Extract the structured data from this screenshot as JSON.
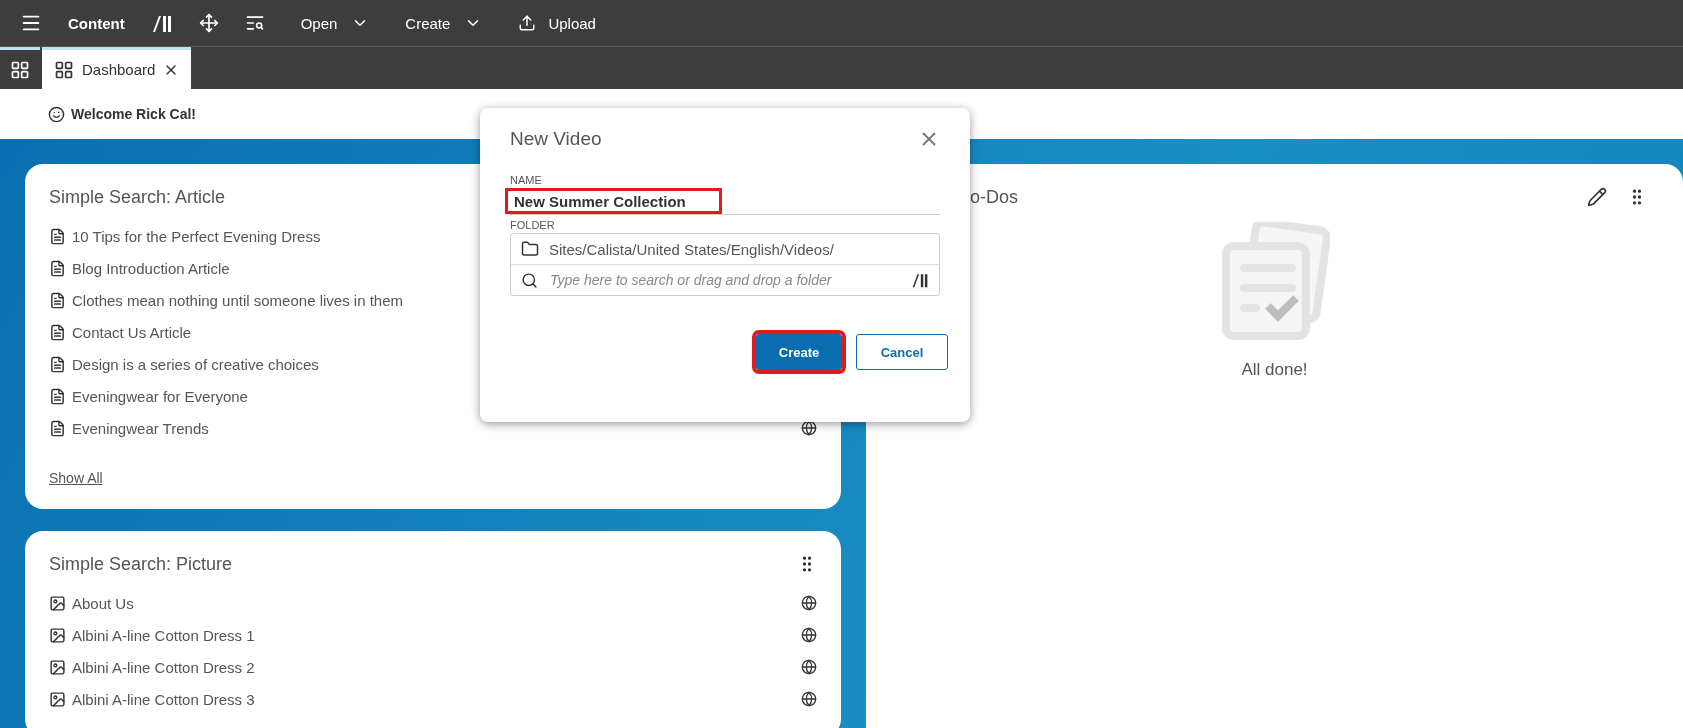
{
  "toolbar": {
    "title": "Content",
    "menus": [
      {
        "label": "Open",
        "kind": "dropdown"
      },
      {
        "label": "Create",
        "kind": "dropdown"
      },
      {
        "label": "Upload",
        "kind": "upload"
      }
    ]
  },
  "tabs": [
    {
      "kind": "home",
      "selected": false
    },
    {
      "kind": "page",
      "label": "Dashboard",
      "selected": true
    }
  ],
  "welcome": "Welcome Rick Cal!",
  "widgets": [
    {
      "title": "Simple Search: Article",
      "kind": "article",
      "items": [
        "10 Tips for the Perfect Evening Dress",
        "Blog Introduction Article",
        "Clothes mean nothing until someone lives in them",
        "Contact Us Article",
        "Design is a series of creative choices",
        "Eveningwear for Everyone",
        "Eveningwear Trends"
      ],
      "link": "Show All"
    },
    {
      "title": "Simple Search: Picture",
      "kind": "picture",
      "items": [
        "About Us",
        "Albini A-line Cotton Dress 1",
        "Albini A-line Cotton Dress 2",
        "Albini A-line Cotton Dress 3"
      ]
    }
  ],
  "todos": {
    "title": "o-Dos",
    "empty_text": "All done!"
  },
  "dialog": {
    "title": "New Video",
    "name_label": "NAME",
    "name_value": "New Summer Collection",
    "name_highlighted": true,
    "folder_label": "FOLDER",
    "folder_path": "Sites/Calista/United States/English/Videos/",
    "folder_placeholder": "Type here to search or drag and drop a folder",
    "buttons": [
      {
        "label": "Create",
        "kind": "primary",
        "highlighted": true
      },
      {
        "label": "Cancel",
        "kind": "secondary",
        "highlighted": false
      }
    ]
  }
}
